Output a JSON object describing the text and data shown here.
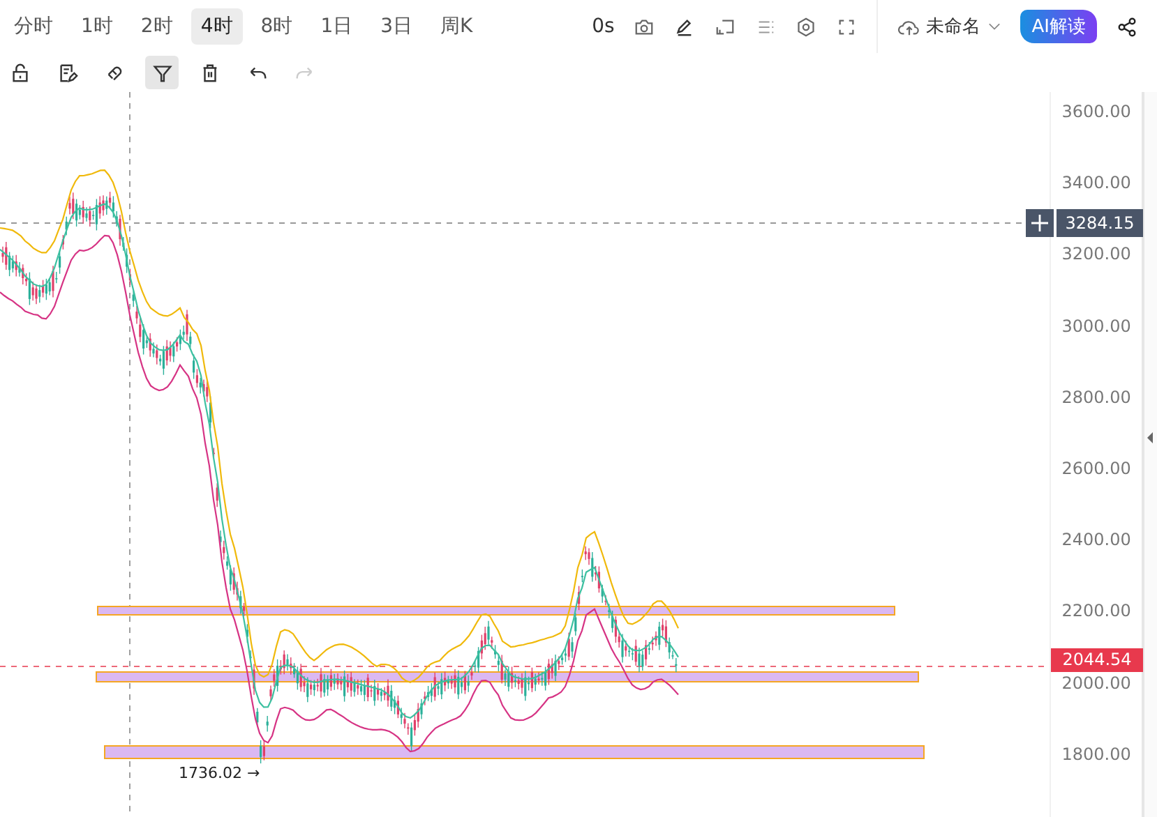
{
  "timeframes": [
    {
      "label": "分时",
      "selected": false
    },
    {
      "label": "1时",
      "selected": false
    },
    {
      "label": "2时",
      "selected": false
    },
    {
      "label": "4时",
      "selected": true
    },
    {
      "label": "8时",
      "selected": false
    },
    {
      "label": "1日",
      "selected": false
    },
    {
      "label": "3日",
      "selected": false
    },
    {
      "label": "周K",
      "selected": false
    }
  ],
  "timer": "0s",
  "layout_name": "未命名",
  "ai_button": "AI解读",
  "drawing_tools": [
    {
      "kind": "lock",
      "selected": false,
      "disabled": false
    },
    {
      "kind": "edit",
      "selected": false,
      "disabled": false
    },
    {
      "kind": "magnet",
      "selected": false,
      "disabled": false
    },
    {
      "kind": "filter",
      "selected": true,
      "disabled": false
    },
    {
      "kind": "trash",
      "selected": false,
      "disabled": false
    },
    {
      "kind": "undo",
      "selected": false,
      "disabled": false
    },
    {
      "kind": "redo",
      "selected": false,
      "disabled": true
    }
  ],
  "price_axis": {
    "labels": [
      "3600.00",
      "3400.00",
      "3200.00",
      "3000.00",
      "2800.00",
      "2600.00",
      "2400.00",
      "2200.00",
      "2000.00",
      "1800.00"
    ]
  },
  "price_tags": [
    {
      "kind": "marker",
      "label": "3284.15"
    },
    {
      "kind": "last",
      "label": "2044.54"
    }
  ],
  "low_label": "1736.02 →"
}
